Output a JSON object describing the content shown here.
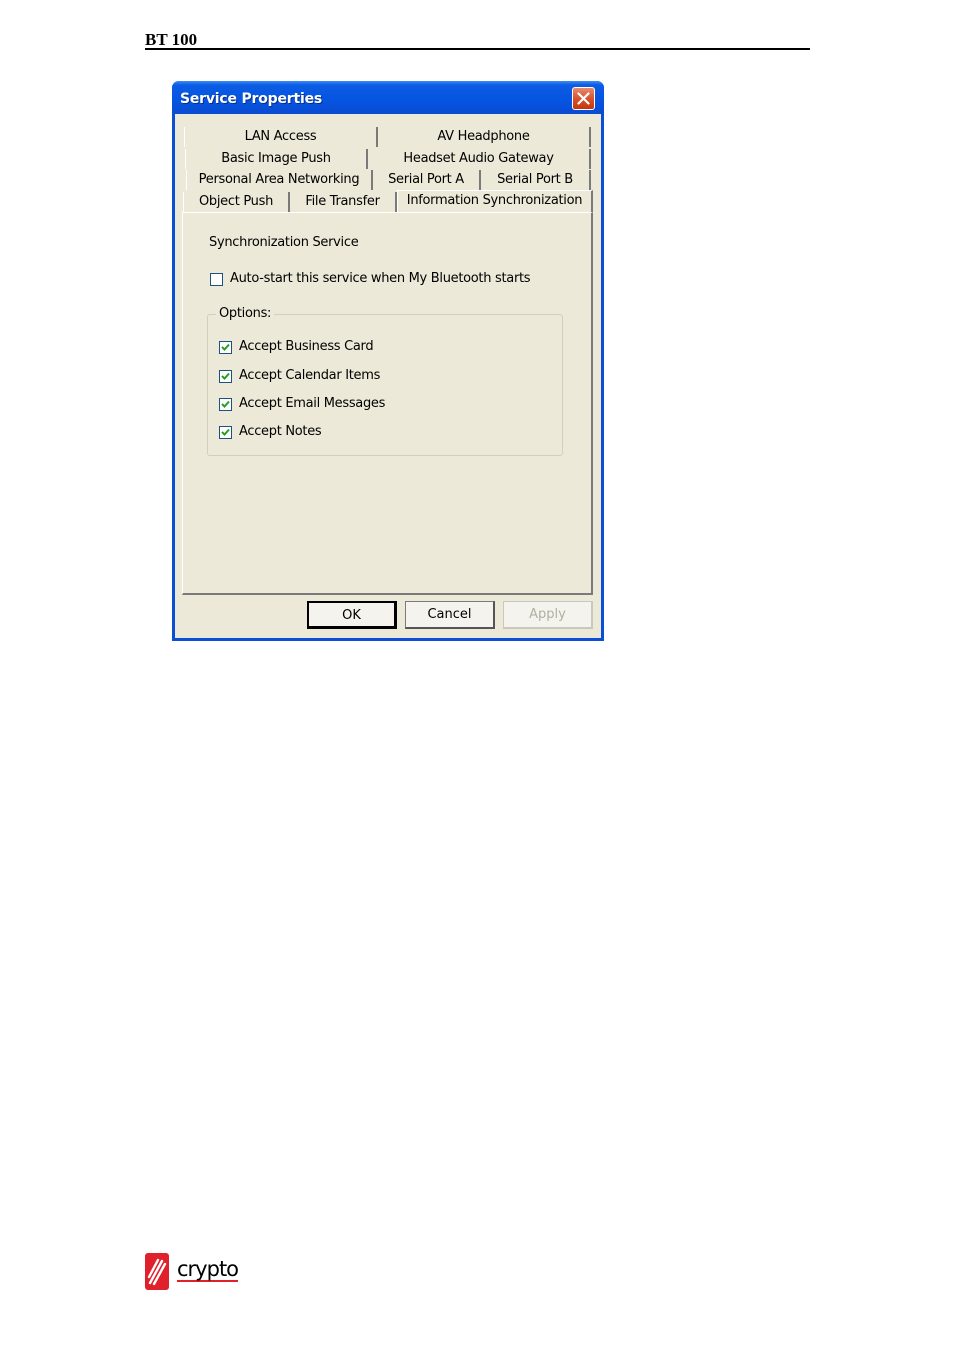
{
  "document": {
    "header": "BT 100",
    "brand": "crypto"
  },
  "dialog": {
    "title": "Service Properties",
    "tabs_row1": [
      "LAN Access",
      "AV Headphone"
    ],
    "tabs_row2": [
      "Basic Image Push",
      "Headset Audio Gateway"
    ],
    "tabs_row3": [
      "Personal Area Networking",
      "Serial Port A",
      "Serial Port B"
    ],
    "tabs_row4": [
      "Object Push",
      "File Transfer",
      "Information Synchronization"
    ],
    "active_tab": "Information Synchronization",
    "panel": {
      "service_name": "Synchronization Service",
      "autostart_label": "Auto-start this service when My Bluetooth starts",
      "autostart_checked": false,
      "options_legend": "Options:",
      "options": [
        {
          "label": "Accept Business Card",
          "checked": true
        },
        {
          "label": "Accept Calendar Items",
          "checked": true
        },
        {
          "label": "Accept Email Messages",
          "checked": true
        },
        {
          "label": "Accept Notes",
          "checked": true
        }
      ]
    },
    "buttons": {
      "ok": "OK",
      "cancel": "Cancel",
      "apply": "Apply"
    }
  },
  "colors": {
    "title_bar": "#0554e2",
    "dialog_face": "#ece9d8",
    "close_button": "#d8522c",
    "brand_red": "#e0202a"
  }
}
